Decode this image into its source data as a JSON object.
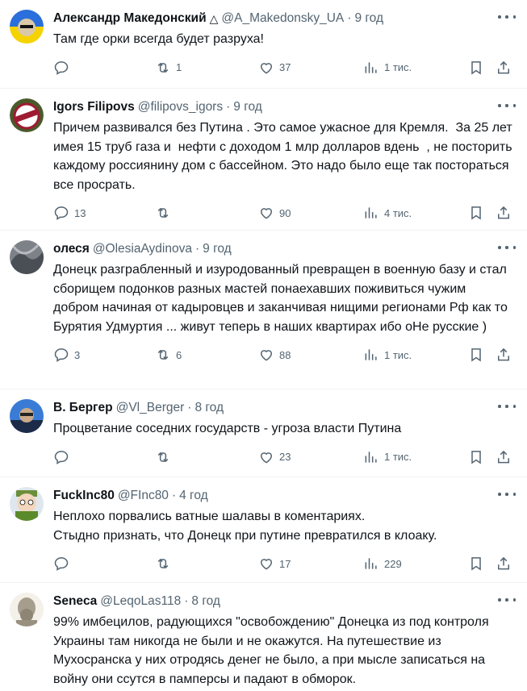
{
  "tweets": [
    {
      "name": "Александр Македонский",
      "badge": "△",
      "handle": "@A_Makedonsky_UA",
      "time": "9 год",
      "text": "Там где орки всегда будет разруха!",
      "replies": "",
      "retweets": "1",
      "likes": "37",
      "views": "1 тис."
    },
    {
      "name": "Igors Filipovs",
      "handle": "@filipovs_igors",
      "time": "9 год",
      "text": "Причем развивался без Путина . Это самое ужасное для Кремля.  За 25 лет имея 15 труб газа и  нефти с доходом 1 млр долларов вдень  , не посторить  каждому россиянину дом с бассейном. Это надо было еще так постораться все просрать.",
      "replies": "13",
      "retweets": "",
      "likes": "90",
      "views": "4 тис."
    },
    {
      "name": "олеся",
      "handle": "@OlesiaAydinova",
      "time": "9 год",
      "text": "Донецк разграбленный и изуродованный превращен в военную базу и стал сборищем подонков разных мастей понаехавших поживиться чужим добром начиная от кадыровцев и заканчивая нищими регионами Рф как то Бурятия Удмуртия ... живут теперь в наших квартирах ибо оНе русские )",
      "replies": "3",
      "retweets": "6",
      "likes": "88",
      "views": "1 тис."
    },
    {
      "name": "В. Бергер",
      "handle": "@Vl_Berger",
      "time": "8 год",
      "text": "Процветание соседних государств - угроза власти Путина",
      "replies": "",
      "retweets": "",
      "likes": "23",
      "views": "1 тис."
    },
    {
      "name": "FuckInc80",
      "handle": "@FInc80",
      "time": "4 год",
      "text": "Неплохо порвались ватные шалавы в коментариях.\nСтыдно признать, что Донецк при путине превратился в клоаку.",
      "replies": "",
      "retweets": "",
      "likes": "17",
      "views": "229"
    },
    {
      "name": "Seneca",
      "handle": "@LeqoLas118",
      "time": "8 год",
      "text": "99% имбецилов, радующихся \"освобождению\" Донецка из под контроля Украины там никогда не были и не окажутся. На путешествие из Мухосранска у них отродясь денег не было, а при мысле записаться на войну они ссутся в памперсы и падают в обморок.",
      "replies": "",
      "retweets": "",
      "likes": "",
      "views": ""
    }
  ],
  "colors": {
    "text": "#0f1419",
    "secondary": "#536471",
    "divider": "#eff3f4"
  }
}
